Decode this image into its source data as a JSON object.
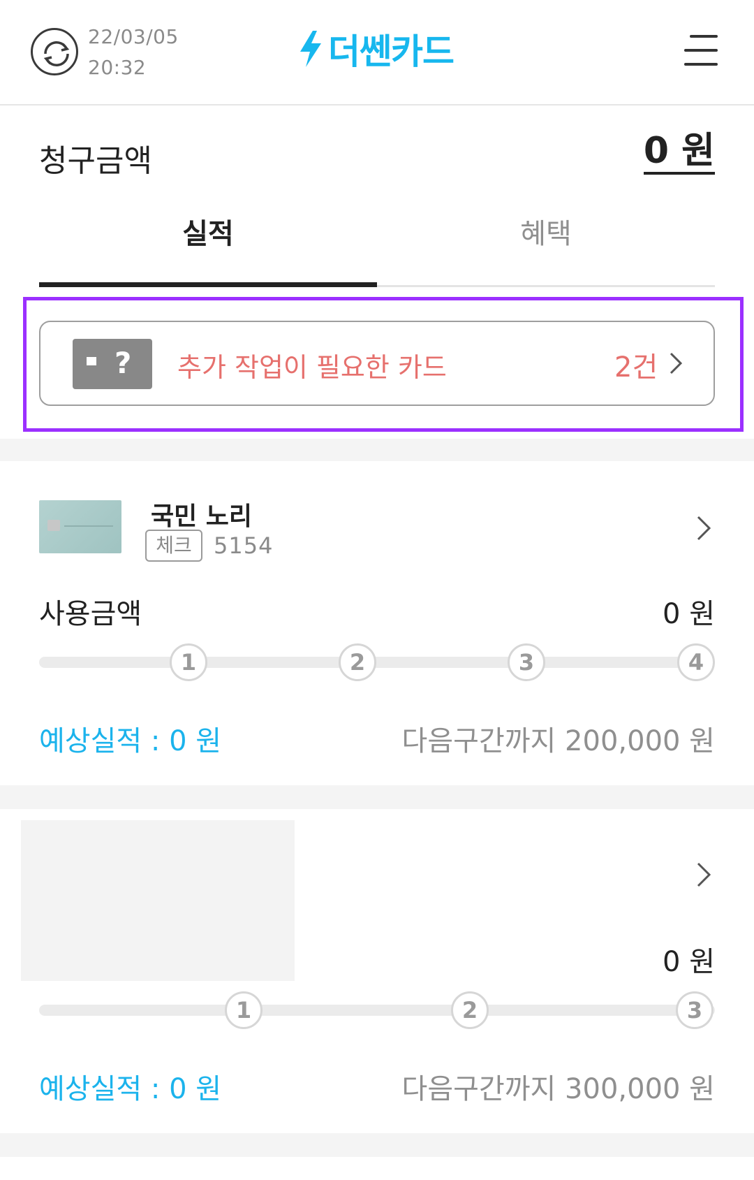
{
  "header": {
    "sync_date": "22/03/05",
    "sync_time": "20:32",
    "logo_text": "더쎈카드",
    "brand_color": "#17b7ee",
    "icons": {
      "refresh": "refresh-icon",
      "menu": "menu-icon",
      "logo": "bolt-icon"
    }
  },
  "billing": {
    "label": "청구금액",
    "amount": "0 원"
  },
  "tabs": [
    {
      "label": "실적",
      "active": true
    },
    {
      "label": "혜택",
      "active": false
    }
  ],
  "alert": {
    "text": "추가 작업이 필요한 카드",
    "count": "2건",
    "icon": "card-unknown-icon",
    "accent_color": "#e6706d",
    "highlight_color": "#9b30ff"
  },
  "cards": [
    {
      "name": "국민 노리",
      "type_badge": "체크",
      "number": "5154",
      "usage_label": "사용금액",
      "usage_amount": "0 원",
      "steps": [
        "1",
        "2",
        "3",
        "4"
      ],
      "expected": "예상실적 : 0 원",
      "to_next": "다음구간까지 200,000 원"
    },
    {
      "usage_amount": "0 원",
      "steps": [
        "1",
        "2",
        "3"
      ],
      "expected": "예상실적 : 0 원",
      "to_next": "다음구간까지 300,000 원"
    }
  ],
  "accent_color": "#1bb3ec"
}
